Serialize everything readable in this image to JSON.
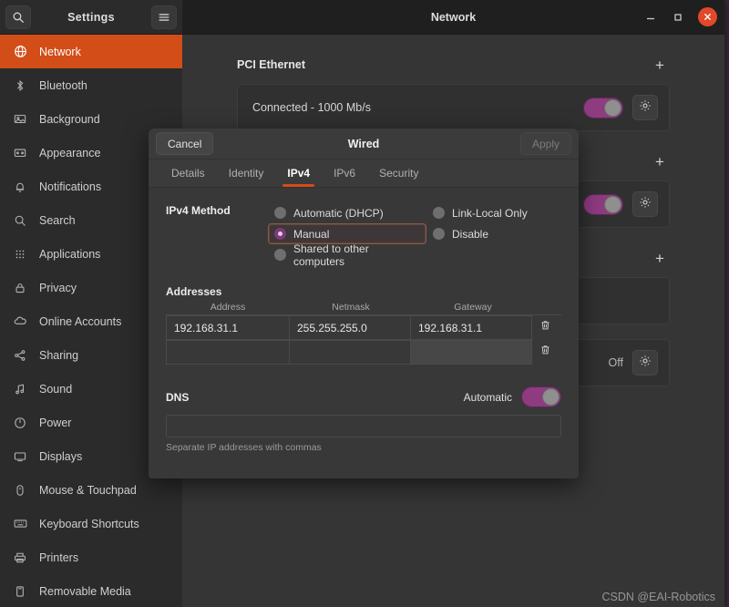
{
  "titlebar": {
    "settings_title": "Settings",
    "window_title": "Network",
    "search_icon": "search-icon",
    "menu_icon": "hamburger-menu-icon",
    "minimize_label": "–",
    "maximize_label": "□",
    "close_label": "✕"
  },
  "sidebar": {
    "items": [
      {
        "label": "Network",
        "icon": "network-icon",
        "active": true
      },
      {
        "label": "Bluetooth",
        "icon": "bluetooth-icon",
        "active": false
      },
      {
        "label": "Background",
        "icon": "background-icon",
        "active": false
      },
      {
        "label": "Appearance",
        "icon": "appearance-icon",
        "active": false
      },
      {
        "label": "Notifications",
        "icon": "bell-icon",
        "active": false
      },
      {
        "label": "Search",
        "icon": "search-icon",
        "active": false
      },
      {
        "label": "Applications",
        "icon": "grid-icon",
        "active": false
      },
      {
        "label": "Privacy",
        "icon": "lock-icon",
        "active": false
      },
      {
        "label": "Online Accounts",
        "icon": "cloud-icon",
        "active": false
      },
      {
        "label": "Sharing",
        "icon": "share-icon",
        "active": false
      },
      {
        "label": "Sound",
        "icon": "note-icon",
        "active": false
      },
      {
        "label": "Power",
        "icon": "power-icon",
        "active": false
      },
      {
        "label": "Displays",
        "icon": "display-icon",
        "active": false
      },
      {
        "label": "Mouse & Touchpad",
        "icon": "mouse-icon",
        "active": false
      },
      {
        "label": "Keyboard Shortcuts",
        "icon": "keyboard-icon",
        "active": false
      },
      {
        "label": "Printers",
        "icon": "printer-icon",
        "active": false
      },
      {
        "label": "Removable Media",
        "icon": "media-icon",
        "active": false
      }
    ]
  },
  "content": {
    "sections": [
      {
        "title": "PCI Ethernet",
        "add_label": "+",
        "row": {
          "label": "Connected - 1000 Mb/s",
          "toggle": "on",
          "gear": "gear-icon"
        }
      },
      {
        "title": "",
        "add_label": "+",
        "row": {
          "label": "",
          "toggle": "on",
          "gear": "gear-icon"
        }
      },
      {
        "title": "",
        "add_label": "+",
        "row": {
          "label": "",
          "toggle": "none",
          "gear": ""
        }
      },
      {
        "title": "",
        "add_label": "",
        "row": {
          "label": "",
          "toggle": "off-text",
          "off_label": "Off",
          "gear": "gear-icon"
        }
      }
    ]
  },
  "dialog": {
    "cancel_label": "Cancel",
    "title": "Wired",
    "apply_label": "Apply",
    "apply_disabled": true,
    "tabs": [
      {
        "label": "Details",
        "active": false
      },
      {
        "label": "Identity",
        "active": false
      },
      {
        "label": "IPv4",
        "active": true
      },
      {
        "label": "IPv6",
        "active": false
      },
      {
        "label": "Security",
        "active": false
      }
    ],
    "ipv4_method": {
      "label": "IPv4 Method",
      "options": [
        {
          "label": "Automatic (DHCP)",
          "selected": false,
          "focused": false,
          "col": "left"
        },
        {
          "label": "Link-Local Only",
          "selected": false,
          "focused": false,
          "col": "right"
        },
        {
          "label": "Manual",
          "selected": true,
          "focused": true,
          "col": "left"
        },
        {
          "label": "Disable",
          "selected": false,
          "focused": false,
          "col": "right"
        },
        {
          "label": "Shared to other computers",
          "selected": false,
          "focused": false,
          "col": "left"
        }
      ]
    },
    "addresses": {
      "label": "Addresses",
      "columns": [
        "Address",
        "Netmask",
        "Gateway"
      ],
      "delete_icon": "trash-icon",
      "rows": [
        {
          "address": "192.168.31.1",
          "netmask": "255.255.255.0",
          "gateway": "192.168.31.1",
          "highlight": "none"
        },
        {
          "address": "",
          "netmask": "",
          "gateway": "",
          "highlight": "gateway"
        }
      ]
    },
    "dns": {
      "label": "DNS",
      "automatic_label": "Automatic",
      "automatic_on": true,
      "value": "",
      "hint": "Separate IP addresses with commas"
    }
  },
  "watermark": {
    "text": "CSDN @EAI-Robotics"
  },
  "colors": {
    "accent_orange": "#d24d18",
    "toggle_purple": "#8e3b80",
    "close_red": "#e0492a",
    "window_bg": "#353535",
    "sidebar_bg": "#2b2b2b",
    "dialog_bg": "#383838"
  }
}
